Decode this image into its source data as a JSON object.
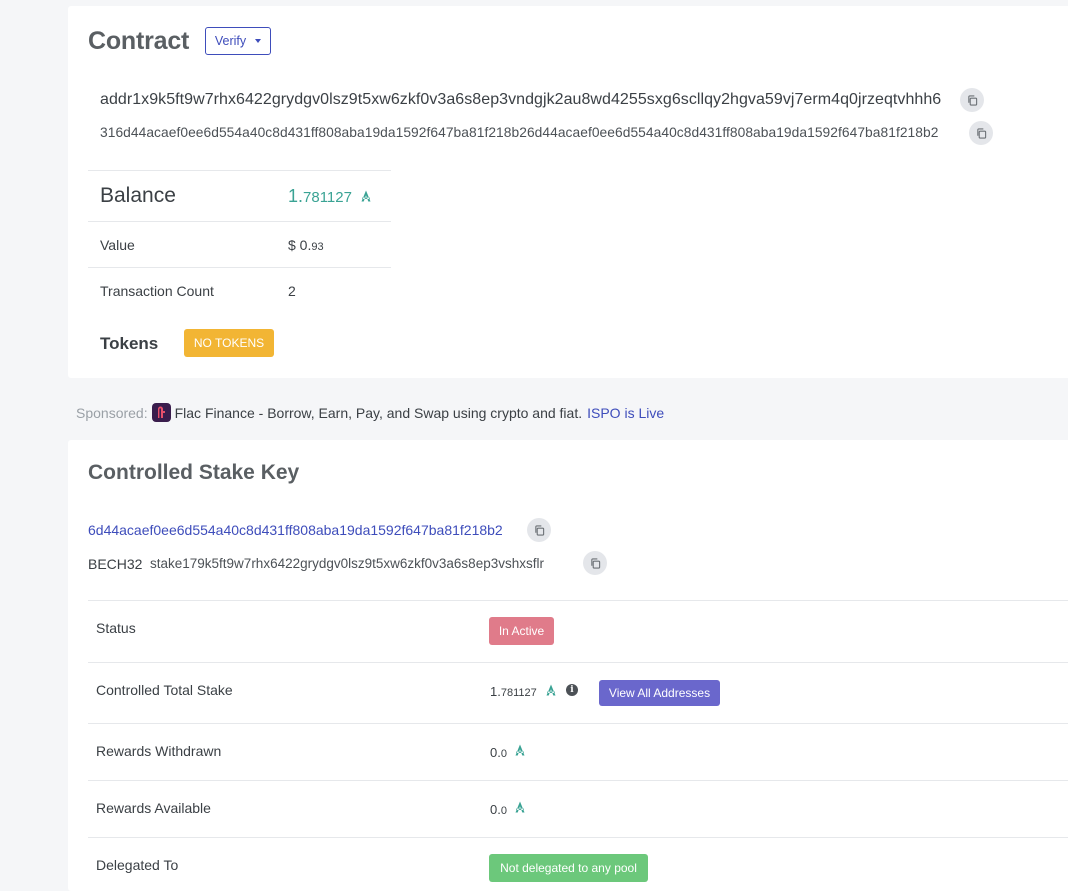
{
  "contract": {
    "title": "Contract",
    "verify_label": "Verify",
    "address": "addr1x9k5ft9w7rhx6422grydgv0lsz9t5xw6zkf0v3a6s8ep3vndgjk2au8wd4255sxg6scllqy2hgva59vj7erm4q0jrzeqtvhhh6",
    "hex": "316d44acaef0ee6d554a40c8d431ff808aba19da1592f647ba81f218b26d44acaef0ee6d554a40c8d431ff808aba19da1592f647ba81f218b2",
    "balance_label": "Balance",
    "balance_main": "1.",
    "balance_frac": "781127",
    "value_label": "Value",
    "value_main": "$ 0.",
    "value_frac": "93",
    "tx_count_label": "Transaction Count",
    "tx_count": "2",
    "tokens_label": "Tokens",
    "no_tokens_badge": "NO TOKENS"
  },
  "sponsored": {
    "label": "Sponsored:",
    "text": "Flac Finance - Borrow, Earn, Pay, and Swap using crypto and fiat.",
    "link": "ISPO is Live"
  },
  "stake": {
    "title": "Controlled Stake Key",
    "hex": "6d44acaef0ee6d554a40c8d431ff808aba19da1592f647ba81f218b2",
    "bech32_label": "BECH32",
    "bech32_value": "stake179k5ft9w7rhx6422grydgv0lsz9t5xw6zkf0v3a6s8ep3vshxsflr",
    "rows": [
      {
        "label": "Status",
        "badge": "In Active"
      },
      {
        "label": "Controlled Total Stake",
        "main": "1.",
        "frac": "781127",
        "button": "View All Addresses"
      },
      {
        "label": "Rewards Withdrawn",
        "main": "0.",
        "frac": "0"
      },
      {
        "label": "Rewards Available",
        "main": "0.",
        "frac": "0"
      },
      {
        "label": "Delegated To",
        "badge": "Not delegated to any pool"
      }
    ]
  },
  "colors": {
    "accent_blue": "#3e4dbb",
    "ada_green": "#3aa394",
    "badge_yellow": "#f2b534",
    "badge_red": "#e07b8a",
    "badge_green": "#6cc87b",
    "button_purple": "#6a67cc"
  },
  "icons": [
    "copy-icon",
    "ada-icon",
    "info-icon",
    "chevron-down-icon",
    "flac-logo"
  ]
}
